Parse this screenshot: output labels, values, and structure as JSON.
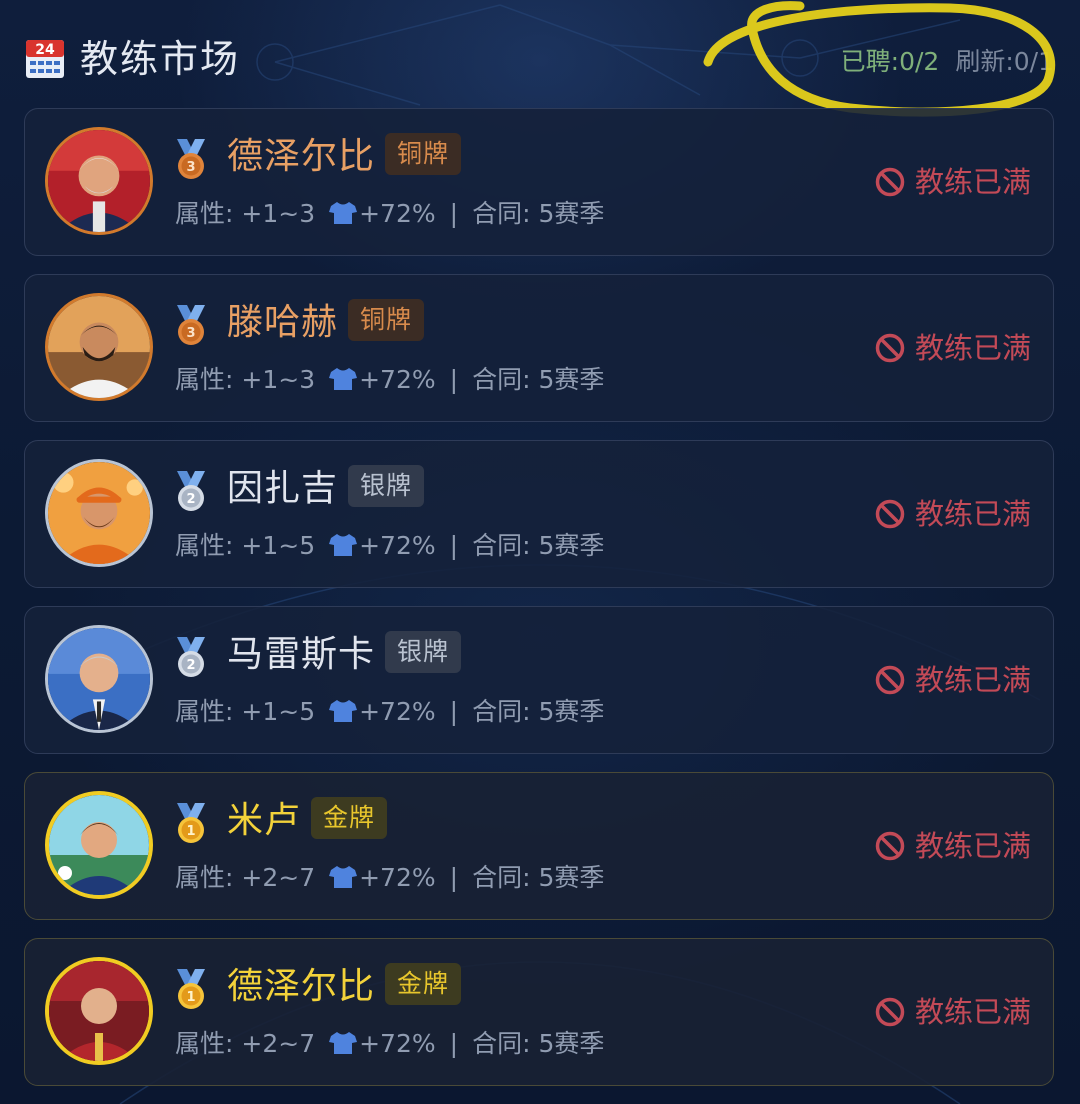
{
  "header": {
    "title": "教练市场",
    "calendar_icon_text": "24",
    "hired": "已聘:0/2",
    "refresh": "刷新:0/1"
  },
  "colors": {
    "bronze": "#d27a2c",
    "silver": "#b9c4d4",
    "gold": "#f1cc22",
    "full_status": "#c34a57",
    "highlight_scribble": "#e6d11a"
  },
  "coaches": [
    {
      "name": "德泽尔比",
      "tier": "铜牌",
      "tier_key": "bronze",
      "medal_number": "3",
      "attr_label": "属性:",
      "attr_value": "+1~3",
      "jersey_bonus": "+72%",
      "contract_label": "合同:",
      "contract_value": "5赛季",
      "status": "教练已满",
      "avatar_icon": "coach-avatar-red-suit"
    },
    {
      "name": "滕哈赫",
      "tier": "铜牌",
      "tier_key": "bronze",
      "medal_number": "3",
      "attr_label": "属性:",
      "attr_value": "+1~3",
      "jersey_bonus": "+72%",
      "contract_label": "合同:",
      "contract_value": "5赛季",
      "status": "教练已满",
      "avatar_icon": "coach-avatar-white-jacket"
    },
    {
      "name": "因扎吉",
      "tier": "银牌",
      "tier_key": "silver",
      "medal_number": "2",
      "attr_label": "属性:",
      "attr_value": "+1~5",
      "jersey_bonus": "+72%",
      "contract_label": "合同:",
      "contract_value": "5赛季",
      "status": "教练已满",
      "avatar_icon": "coach-avatar-orange-kit"
    },
    {
      "name": "马雷斯卡",
      "tier": "银牌",
      "tier_key": "silver",
      "medal_number": "2",
      "attr_label": "属性:",
      "attr_value": "+1~5",
      "jersey_bonus": "+72%",
      "contract_label": "合同:",
      "contract_value": "5赛季",
      "status": "教练已满",
      "avatar_icon": "coach-avatar-navy-suit"
    },
    {
      "name": "米卢",
      "tier": "金牌",
      "tier_key": "gold",
      "medal_number": "1",
      "attr_label": "属性:",
      "attr_value": "+2~7",
      "jersey_bonus": "+72%",
      "contract_label": "合同:",
      "contract_value": "5赛季",
      "status": "教练已满",
      "avatar_icon": "coach-avatar-blue-track"
    },
    {
      "name": "德泽尔比",
      "tier": "金牌",
      "tier_key": "gold",
      "medal_number": "1",
      "attr_label": "属性:",
      "attr_value": "+2~7",
      "jersey_bonus": "+72%",
      "contract_label": "合同:",
      "contract_value": "5赛季",
      "status": "教练已满",
      "avatar_icon": "coach-avatar-red-jacket"
    }
  ]
}
